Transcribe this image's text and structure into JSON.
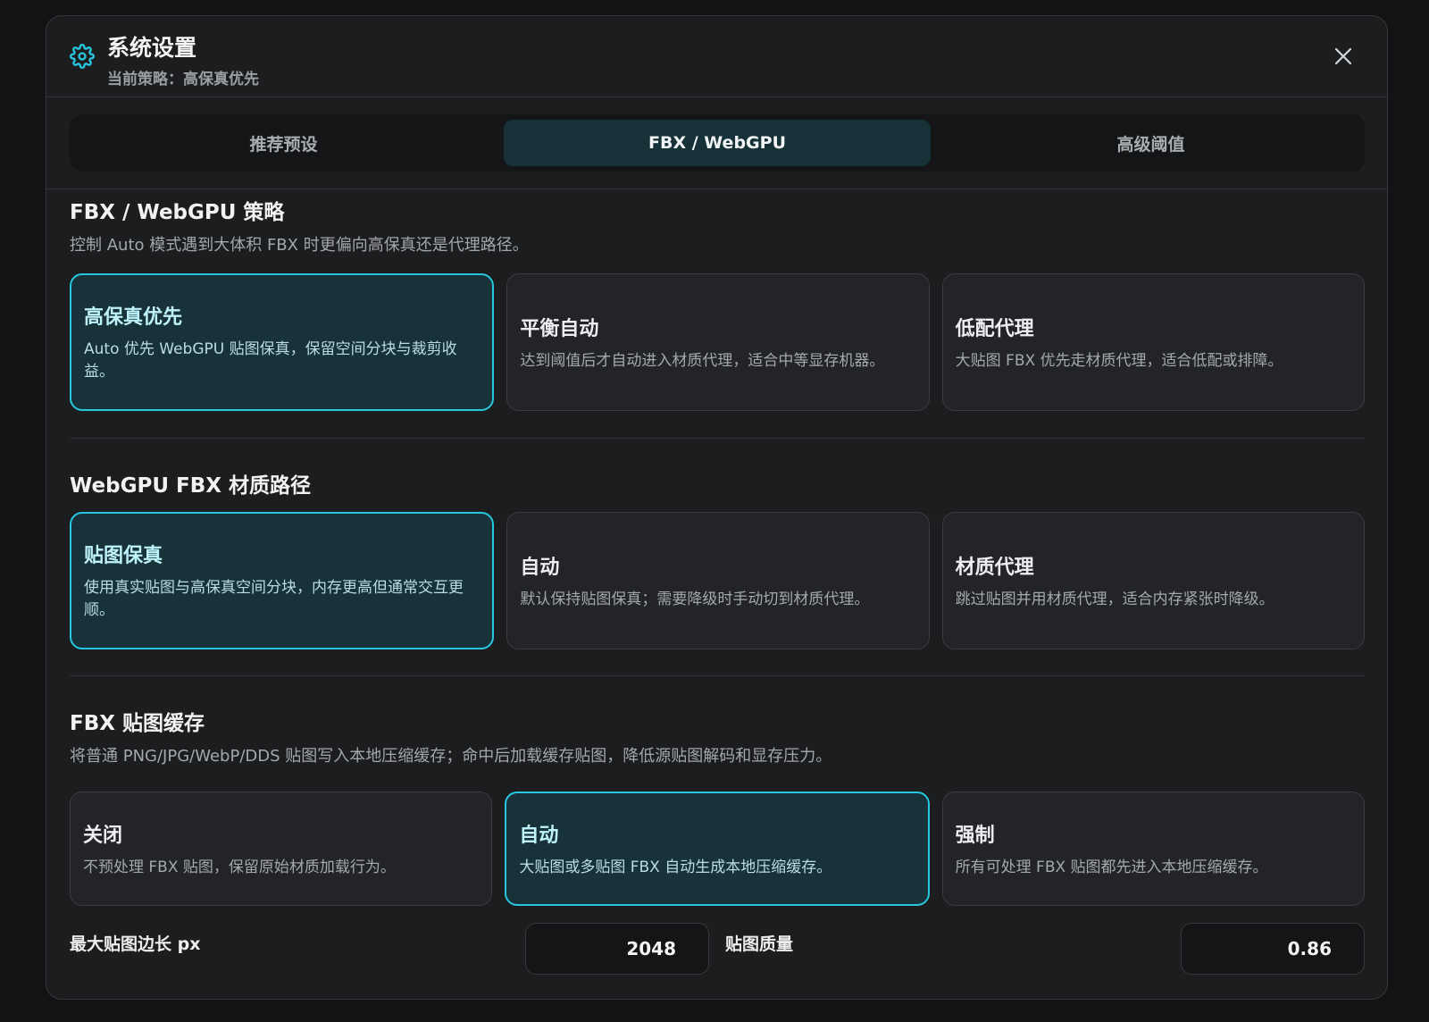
{
  "header": {
    "title": "系统设置",
    "subtitle": "当前策略：高保真优先",
    "accent": "#28c7e0"
  },
  "tabs": [
    {
      "label": "推荐预设",
      "active": false
    },
    {
      "label": "FBX / WebGPU",
      "active": true
    },
    {
      "label": "高级阈值",
      "active": false
    }
  ],
  "sections": {
    "strategy": {
      "title": "FBX / WebGPU 策略",
      "desc": "控制 Auto 模式遇到大体积 FBX 时更偏向高保真还是代理路径。",
      "options": [
        {
          "title": "高保真优先",
          "desc": "Auto 优先 WebGPU 贴图保真，保留空间分块与裁剪收益。",
          "selected": true
        },
        {
          "title": "平衡自动",
          "desc": "达到阈值后才自动进入材质代理，适合中等显存机器。",
          "selected": false
        },
        {
          "title": "低配代理",
          "desc": "大贴图 FBX 优先走材质代理，适合低配或排障。",
          "selected": false
        }
      ]
    },
    "material": {
      "title": "WebGPU FBX 材质路径",
      "options": [
        {
          "title": "贴图保真",
          "desc": "使用真实贴图与高保真空间分块，内存更高但通常交互更顺。",
          "selected": true
        },
        {
          "title": "自动",
          "desc": "默认保持贴图保真；需要降级时手动切到材质代理。",
          "selected": false
        },
        {
          "title": "材质代理",
          "desc": "跳过贴图并用材质代理，适合内存紧张时降级。",
          "selected": false
        }
      ]
    },
    "cache": {
      "title": "FBX 贴图缓存",
      "desc": "将普通 PNG/JPG/WebP/DDS 贴图写入本地压缩缓存；命中后加载缓存贴图，降低源贴图解码和显存压力。",
      "options": [
        {
          "title": "关闭",
          "desc": "不预处理 FBX 贴图，保留原始材质加载行为。",
          "selected": false
        },
        {
          "title": "自动",
          "desc": "大贴图或多贴图 FBX 自动生成本地压缩缓存。",
          "selected": true
        },
        {
          "title": "强制",
          "desc": "所有可处理 FBX 贴图都先进入本地压缩缓存。",
          "selected": false
        }
      ]
    }
  },
  "fields": {
    "max_edge": {
      "label": "最大贴图边长 px",
      "value": "2048"
    },
    "quality": {
      "label": "贴图质量",
      "value": "0.86"
    }
  }
}
